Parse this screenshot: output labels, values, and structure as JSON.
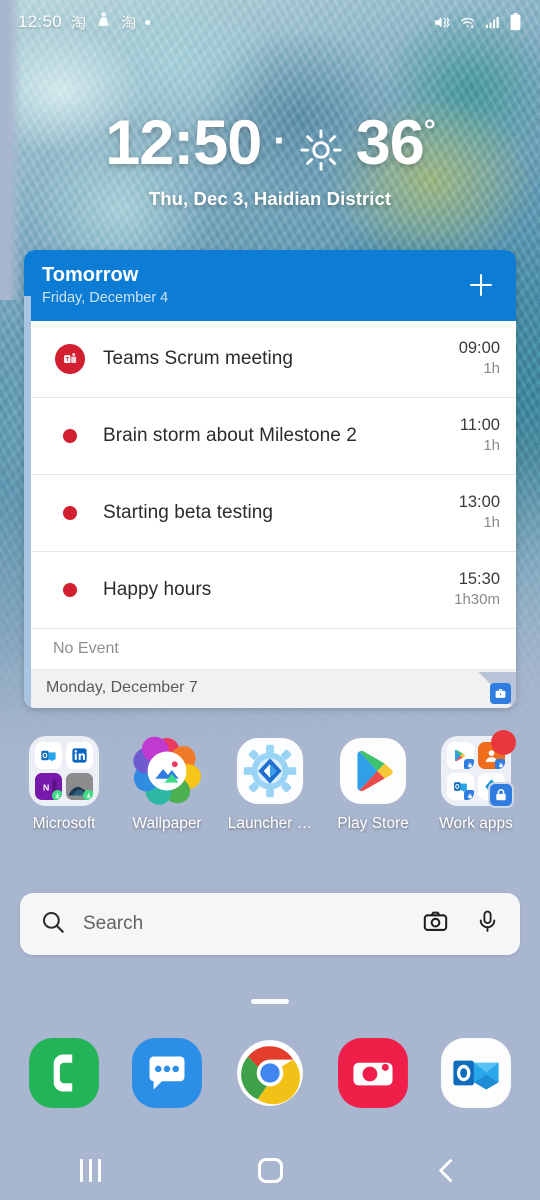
{
  "status_bar": {
    "time": "12:50",
    "notification_icons": [
      "taobao-icon",
      "app-icon",
      "taobao-icon",
      "dot-icon"
    ],
    "glyph_1": "淘",
    "glyph_2": "淘",
    "system_icons": [
      "mute-vibrate-icon",
      "wifi-icon",
      "signal-icon",
      "battery-icon"
    ]
  },
  "clock_widget": {
    "time": "12:50",
    "separator": "·",
    "weather_icon": "sun-icon",
    "temperature": "36",
    "degree": "°",
    "date_location": "Thu, Dec 3,  Haidian District"
  },
  "calendar_widget": {
    "header_title": "Tomorrow",
    "header_subtitle": "Friday, December 4",
    "add_label": "+",
    "events": [
      {
        "icon": "teams-icon",
        "title": "Teams Scrum meeting",
        "time": "09:00",
        "duration": "1h"
      },
      {
        "icon": "red-dot-icon",
        "title": "Brain storm about Milestone 2",
        "time": "11:00",
        "duration": "1h"
      },
      {
        "icon": "red-dot-icon",
        "title": "Starting beta testing",
        "time": "13:00",
        "duration": "1h"
      },
      {
        "icon": "red-dot-icon",
        "title": "Happy hours",
        "time": "15:30",
        "duration": "1h30m"
      }
    ],
    "no_event_label": "No Event",
    "next_day_label": "Monday, December 7",
    "work_badge_icon": "briefcase-icon",
    "accent_color": "#0c7cd5",
    "event_dot_color": "#d32030"
  },
  "apps": [
    {
      "label": "Microsoft",
      "icon": "microsoft-folder-icon"
    },
    {
      "label": "Wallpaper",
      "icon": "wallpaper-icon"
    },
    {
      "label": "Launcher …",
      "icon": "launcher-settings-icon"
    },
    {
      "label": "Play Store",
      "icon": "play-store-icon"
    },
    {
      "label": "Work apps",
      "icon": "work-apps-folder-icon"
    }
  ],
  "search": {
    "placeholder": "Search",
    "search_icon": "search-icon",
    "camera_icon": "camera-icon",
    "mic_icon": "microphone-icon"
  },
  "page_indicator": {
    "pages": 1,
    "current": 1
  },
  "dock": [
    {
      "label": "Phone",
      "icon": "phone-icon"
    },
    {
      "label": "Messages",
      "icon": "messages-icon"
    },
    {
      "label": "Chrome",
      "icon": "chrome-icon"
    },
    {
      "label": "Camera",
      "icon": "camera-app-icon"
    },
    {
      "label": "Outlook",
      "icon": "outlook-icon"
    }
  ],
  "nav_bar": {
    "recents_label": "Recents",
    "home_label": "Home",
    "back_label": "Back"
  }
}
